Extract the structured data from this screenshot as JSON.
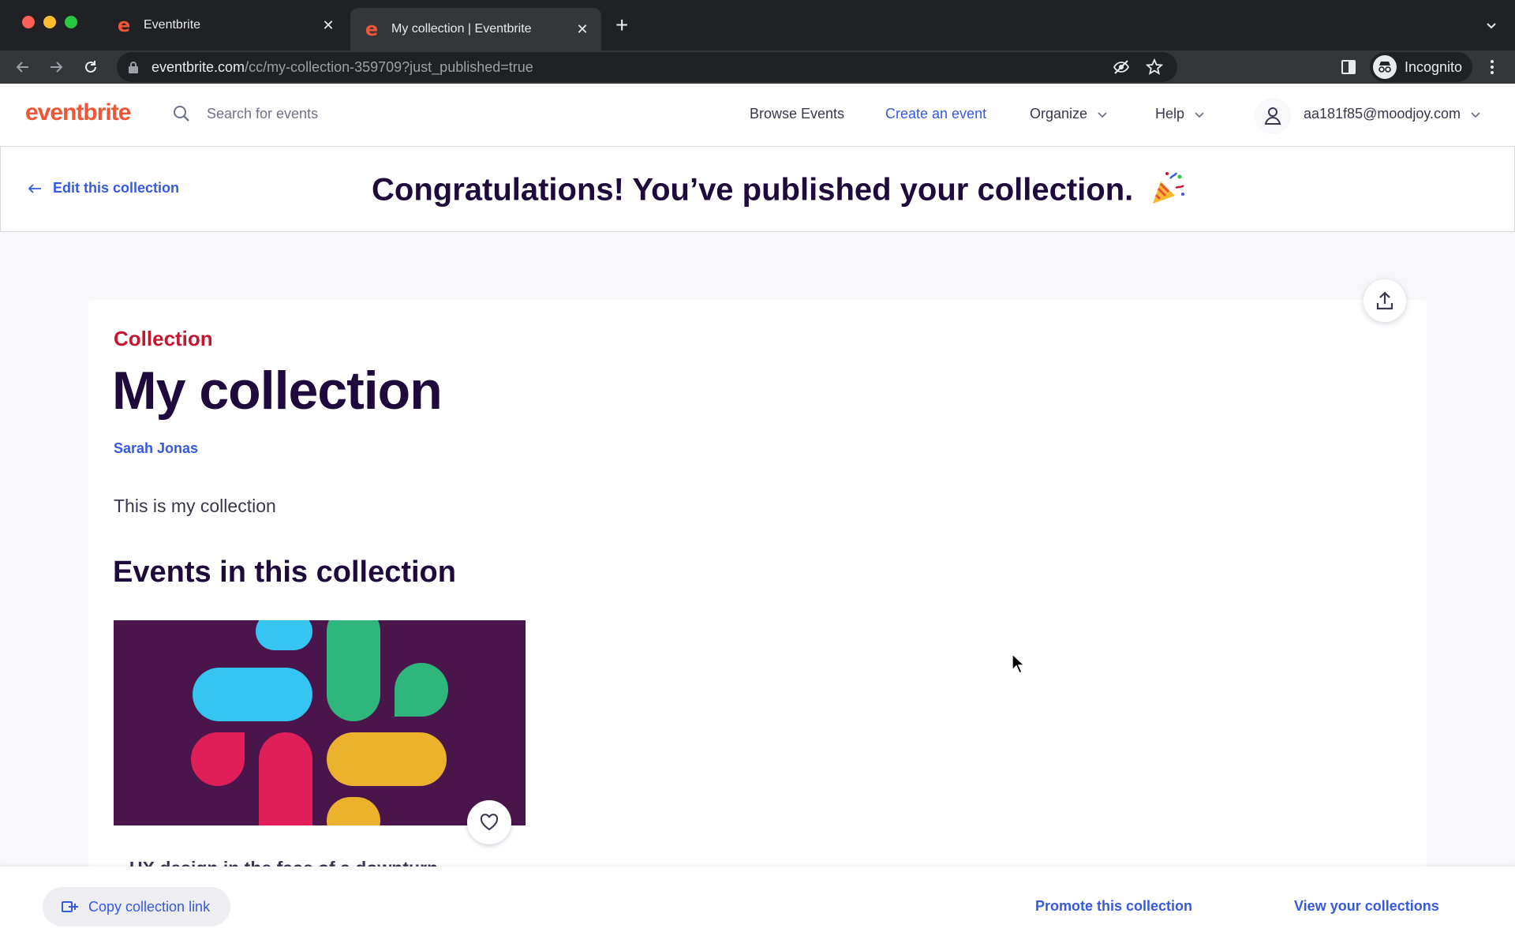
{
  "browser": {
    "tabs": [
      {
        "title": "Eventbrite",
        "active": false
      },
      {
        "title": "My collection | Eventbrite",
        "active": true
      }
    ],
    "url_domain": "eventbrite.com",
    "url_path": "/cc/my-collection-359709?just_published=true",
    "profile_label": "Incognito"
  },
  "header": {
    "logo": "eventbrite",
    "search_placeholder": "Search for events",
    "nav": {
      "browse": "Browse Events",
      "create": "Create an event",
      "organize": "Organize",
      "help": "Help"
    },
    "account_email": "aa181f85@moodjoy.com"
  },
  "banner": {
    "edit_link": "Edit this collection",
    "message": "Congratulations! You’ve published your collection."
  },
  "collection": {
    "kicker": "Collection",
    "title": "My collection",
    "author": "Sarah Jonas",
    "description": "This is my collection",
    "events_heading": "Events in this collection",
    "events": [
      {
        "title": "UX design in the face of a downturn"
      }
    ]
  },
  "actions": {
    "copy_link": "Copy collection link",
    "promote": "Promote this collection",
    "view_collections": "View your collections"
  },
  "colors": {
    "brand_orange": "#f05537",
    "link_blue": "#3659e3",
    "heading_navy": "#1e0a3c",
    "kicker_red": "#c5162e"
  }
}
